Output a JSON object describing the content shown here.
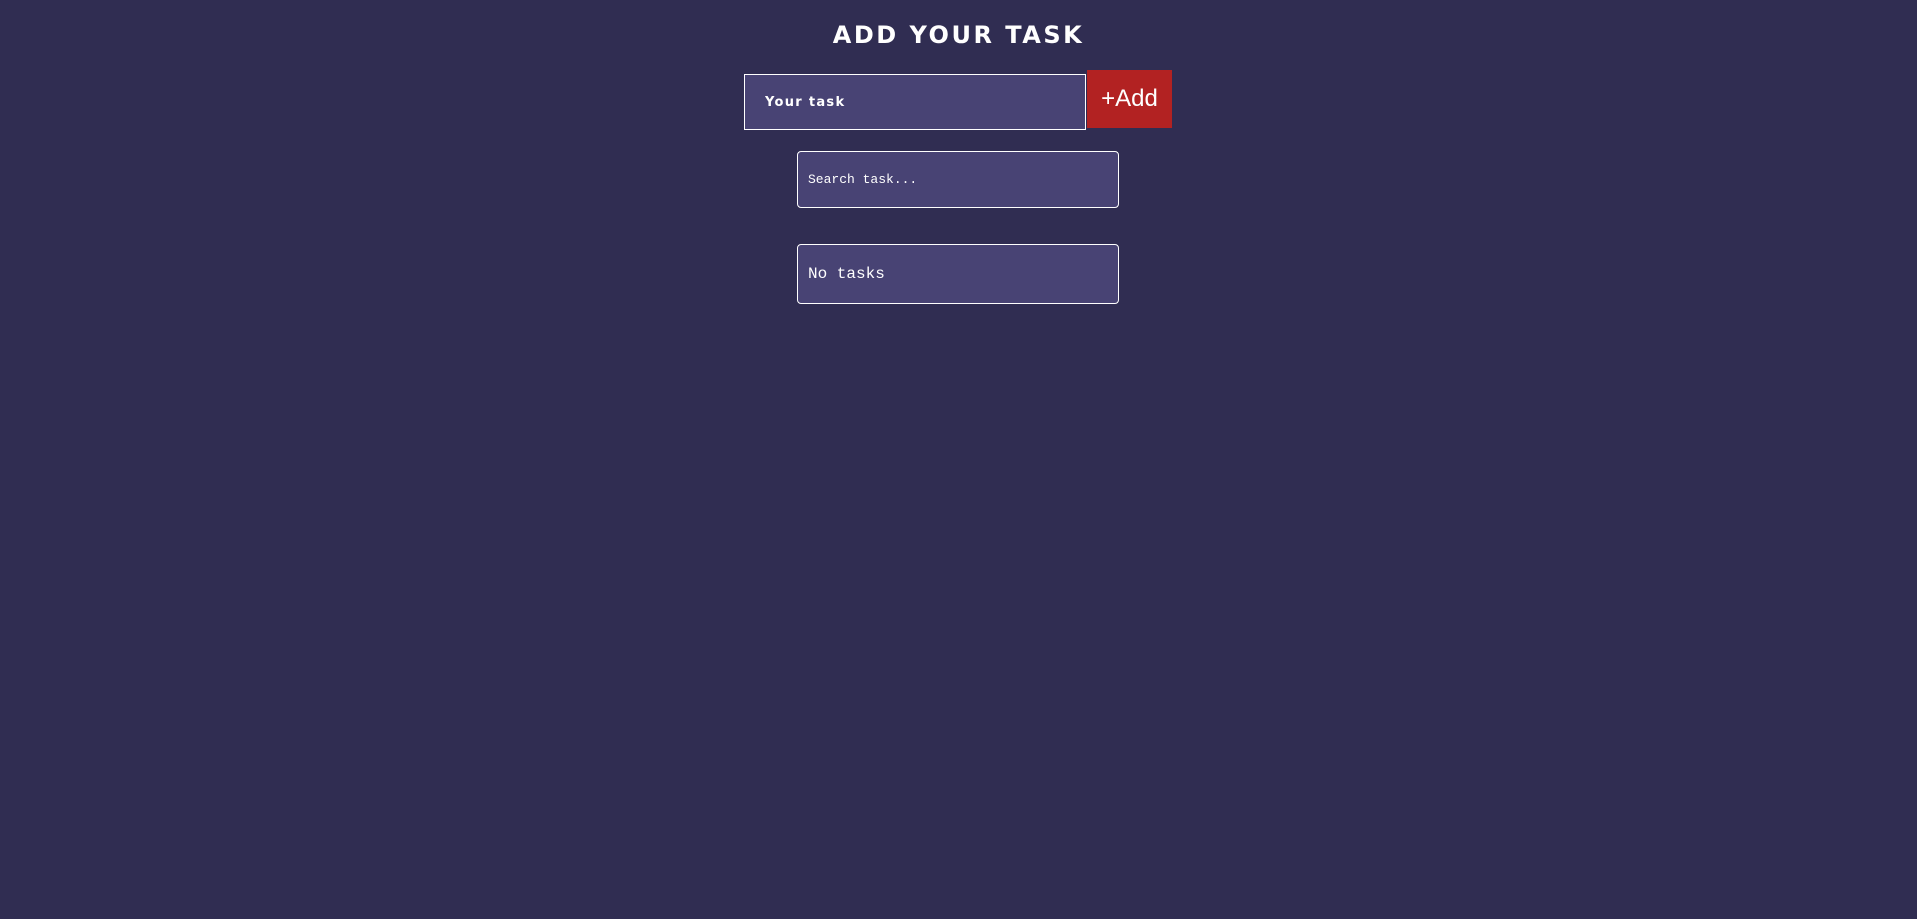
{
  "header": {
    "title": "ADD YOUR TASK"
  },
  "task_form": {
    "input_value": "",
    "input_placeholder": "Your task",
    "add_label": "+Add"
  },
  "search": {
    "value": "",
    "placeholder": "Search task..."
  },
  "task_list": {
    "items": [],
    "empty_text": "No tasks"
  },
  "colors": {
    "background": "#302d52",
    "field": "#484374",
    "accent": "#b22222",
    "text": "#ffffff"
  }
}
